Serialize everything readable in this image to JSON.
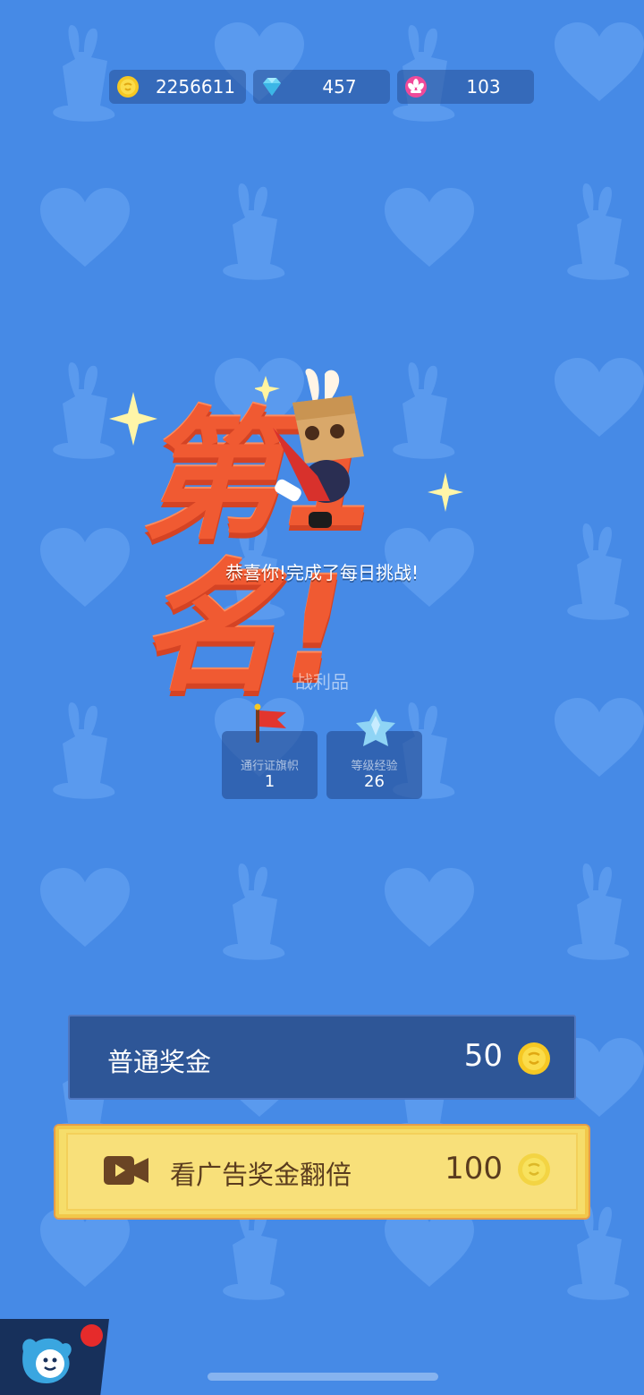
{
  "currencies": [
    {
      "icon": "gold-coin-icon",
      "value": "2256611"
    },
    {
      "icon": "diamond-icon",
      "value": "457"
    },
    {
      "icon": "pink-flower-icon",
      "value": "103"
    }
  ],
  "result": {
    "title": "第1名!",
    "subtitle": "恭喜你!完成了每日挑战!"
  },
  "loot": {
    "header": "战利品",
    "items": [
      {
        "icon": "red-flag-icon",
        "label": "通行证旗帜",
        "amount": "1"
      },
      {
        "icon": "blue-star-gem-icon",
        "label": "等级经验",
        "amount": "26"
      }
    ]
  },
  "rewards": {
    "normal": {
      "label": "普通奖金",
      "amount": "50"
    },
    "ad": {
      "label": "看广告奖金翻倍",
      "amount": "100"
    }
  },
  "colors": {
    "background": "#468ae6",
    "title": "#f05a32",
    "ad_button": "#f6dd6a",
    "normal_button": "#2e5697",
    "notification": "#e62b2b"
  }
}
